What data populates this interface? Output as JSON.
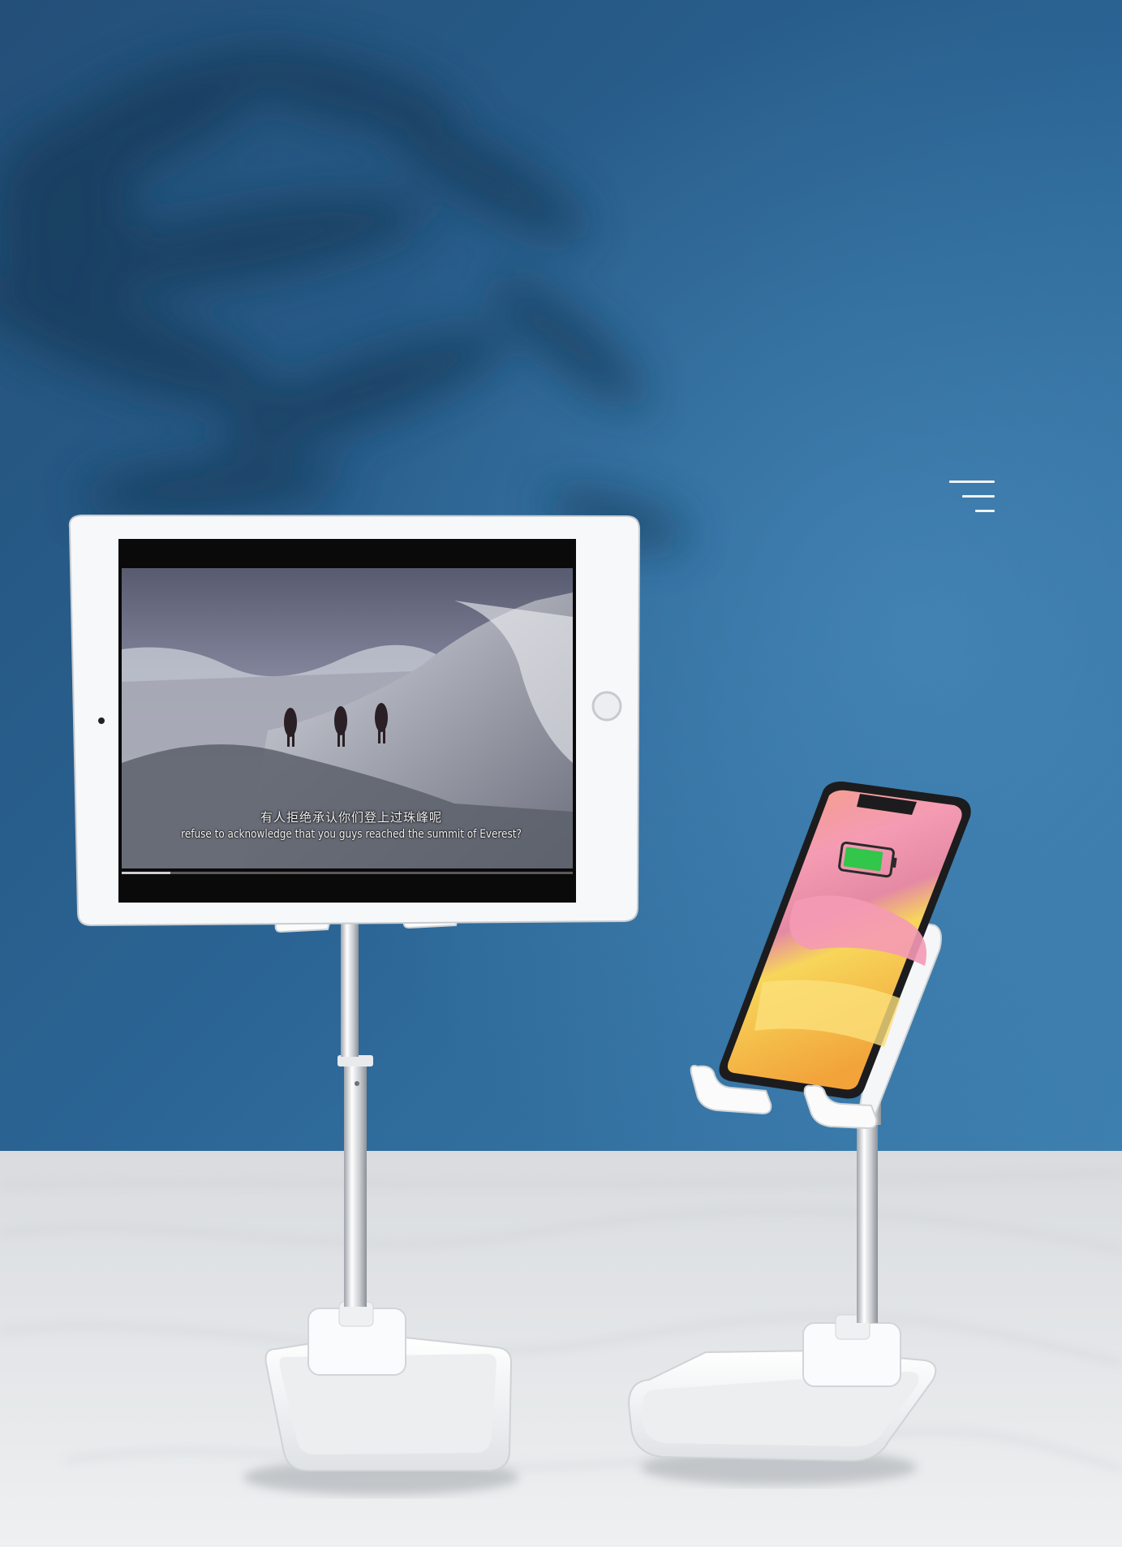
{
  "subtitle": {
    "chinese": "有人拒绝承认你们登上过珠峰呢",
    "english": "refuse to acknowledge that you guys reached the summit of Everest?"
  },
  "icons": {
    "menu": "menu-lines-icon",
    "battery": "battery-charging-icon"
  },
  "colors": {
    "wall": "#2b6595",
    "marble": "#e6e8ea",
    "stand": "#f4f5f6",
    "battery": "#32c64a"
  }
}
